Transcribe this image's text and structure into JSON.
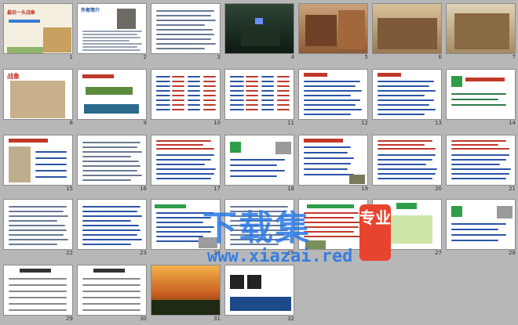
{
  "colors": {
    "background": "#b7b7b7",
    "watermark": "#2878e6",
    "badge": "#e8432f"
  },
  "slides": [
    {
      "num": "1",
      "title": "最后一头战象",
      "style": "cover"
    },
    {
      "num": "2",
      "title": "作者简介",
      "style": "bio"
    },
    {
      "num": "3",
      "title": "",
      "style": "text"
    },
    {
      "num": "4",
      "title": "",
      "style": "photo-dark"
    },
    {
      "num": "5",
      "title": "",
      "style": "photo-war"
    },
    {
      "num": "6",
      "title": "",
      "style": "photo-battle"
    },
    {
      "num": "7",
      "title": "",
      "style": "photo-battle2"
    },
    {
      "num": "8",
      "title": "战象",
      "style": "elephant"
    },
    {
      "num": "9",
      "title": "",
      "style": "chars"
    },
    {
      "num": "10",
      "title": "",
      "style": "list"
    },
    {
      "num": "11",
      "title": "",
      "style": "list"
    },
    {
      "num": "12",
      "title": "",
      "style": "list-blue"
    },
    {
      "num": "13",
      "title": "",
      "style": "list-blue"
    },
    {
      "num": "14",
      "title": "",
      "style": "green-q"
    },
    {
      "num": "15",
      "title": "",
      "style": "elephant-list"
    },
    {
      "num": "16",
      "title": "",
      "style": "text"
    },
    {
      "num": "17",
      "title": "",
      "style": "text-red"
    },
    {
      "num": "18",
      "title": "",
      "style": "elephant-q"
    },
    {
      "num": "19",
      "title": "",
      "style": "list-mix"
    },
    {
      "num": "20",
      "title": "",
      "style": "text-red"
    },
    {
      "num": "21",
      "title": "",
      "style": "text-red"
    },
    {
      "num": "22",
      "title": "",
      "style": "text"
    },
    {
      "num": "23",
      "title": "",
      "style": "text-blue"
    },
    {
      "num": "24",
      "title": "",
      "style": "text-elephant"
    },
    {
      "num": "25",
      "title": "",
      "style": "text"
    },
    {
      "num": "26",
      "title": "",
      "style": "text-img"
    },
    {
      "num": "27",
      "title": "",
      "style": "green-box"
    },
    {
      "num": "28",
      "title": "",
      "style": "elephant-q"
    },
    {
      "num": "29",
      "title": "",
      "style": "lines"
    },
    {
      "num": "30",
      "title": "",
      "style": "lines"
    },
    {
      "num": "31",
      "title": "",
      "style": "photo-sunset"
    },
    {
      "num": "32",
      "title": "",
      "style": "qr"
    }
  ],
  "watermark": {
    "main": "下载集",
    "url": "www.xiazai.red",
    "badge": "专业"
  }
}
